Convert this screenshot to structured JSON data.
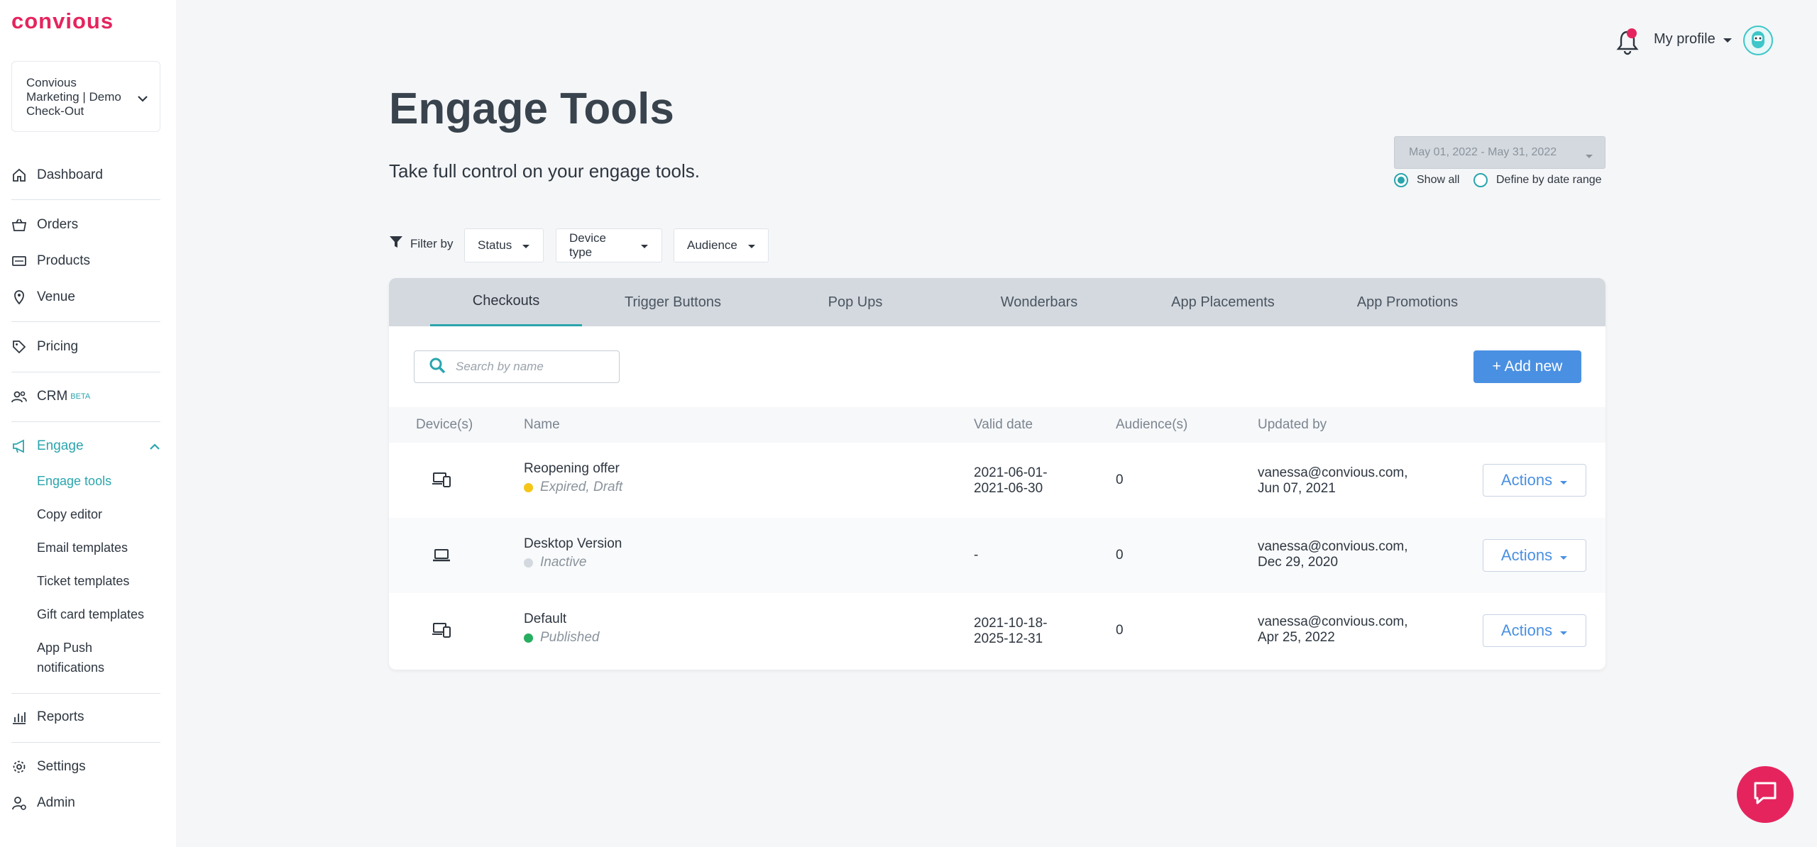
{
  "brand": {
    "logo_text": "convious",
    "accent": "#2aa5ad",
    "brand_color": "#e5245e",
    "primary_blue": "#4a90e2"
  },
  "sidebar": {
    "account_name": "Convious Marketing | Demo Check-Out",
    "items": {
      "dashboard": {
        "label": "Dashboard",
        "icon": "home-icon"
      },
      "orders": {
        "label": "Orders",
        "icon": "basket-icon"
      },
      "products": {
        "label": "Products",
        "icon": "ticket-icon"
      },
      "venue": {
        "label": "Venue",
        "icon": "location-pin-icon"
      },
      "pricing": {
        "label": "Pricing",
        "icon": "tag-icon"
      },
      "crm": {
        "label": "CRM",
        "badge": "BETA",
        "icon": "users-icon"
      },
      "engage": {
        "label": "Engage",
        "icon": "megaphone-icon"
      },
      "reports": {
        "label": "Reports",
        "icon": "chart-icon"
      },
      "settings": {
        "label": "Settings",
        "icon": "gear-icon"
      },
      "admin": {
        "label": "Admin",
        "icon": "user-gear-icon"
      }
    },
    "engage_sub": {
      "engage_tools": "Engage tools",
      "copy_editor": "Copy editor",
      "email_templates": "Email templates",
      "ticket_templates": "Ticket templates",
      "gift_card_templates": "Gift card templates",
      "app_push_line1": "App Push",
      "app_push_line2": "notifications"
    }
  },
  "header": {
    "profile_label": "My profile"
  },
  "main": {
    "title": "Engage Tools",
    "subtitle": "Take full control on your engage tools.",
    "date_range": "May 01, 2022 - May 31, 2022",
    "radio_show_all": "Show all",
    "radio_define": "Define by date range",
    "filter_label": "Filter by",
    "filters": {
      "status": "Status",
      "device_type": "Device type",
      "audience": "Audience"
    },
    "tabs": {
      "checkouts": "Checkouts",
      "trigger_buttons": "Trigger Buttons",
      "pop_ups": "Pop Ups",
      "wonderbars": "Wonderbars",
      "app_placements": "App Placements",
      "app_promotions": "App Promotions"
    },
    "search_placeholder": "Search by name",
    "add_new_label": "+ Add new",
    "columns": {
      "devices": "Device(s)",
      "name": "Name",
      "valid_date": "Valid date",
      "audiences": "Audience(s)",
      "updated_by": "Updated by"
    },
    "rows": [
      {
        "device_icon": "multi-device-icon",
        "name": "Reopening offer",
        "status": "Expired, Draft",
        "status_color": "#f5c518",
        "valid_line1": "2021-06-01-",
        "valid_line2": "2021-06-30",
        "audiences": "0",
        "updated_line1": "vanessa@convious.com,",
        "updated_line2": "Jun 07, 2021",
        "actions": "Actions"
      },
      {
        "device_icon": "laptop-icon",
        "name": "Desktop Version",
        "status": "Inactive",
        "status_color": "#d4d9df",
        "valid_line1": "-",
        "valid_line2": "",
        "audiences": "0",
        "updated_line1": "vanessa@convious.com,",
        "updated_line2": "Dec 29, 2020",
        "actions": "Actions"
      },
      {
        "device_icon": "multi-device-icon",
        "name": "Default",
        "status": "Published",
        "status_color": "#27ae60",
        "valid_line1": "2021-10-18-",
        "valid_line2": "2025-12-31",
        "audiences": "0",
        "updated_line1": "vanessa@convious.com,",
        "updated_line2": "Apr 25, 2022",
        "actions": "Actions"
      }
    ]
  }
}
